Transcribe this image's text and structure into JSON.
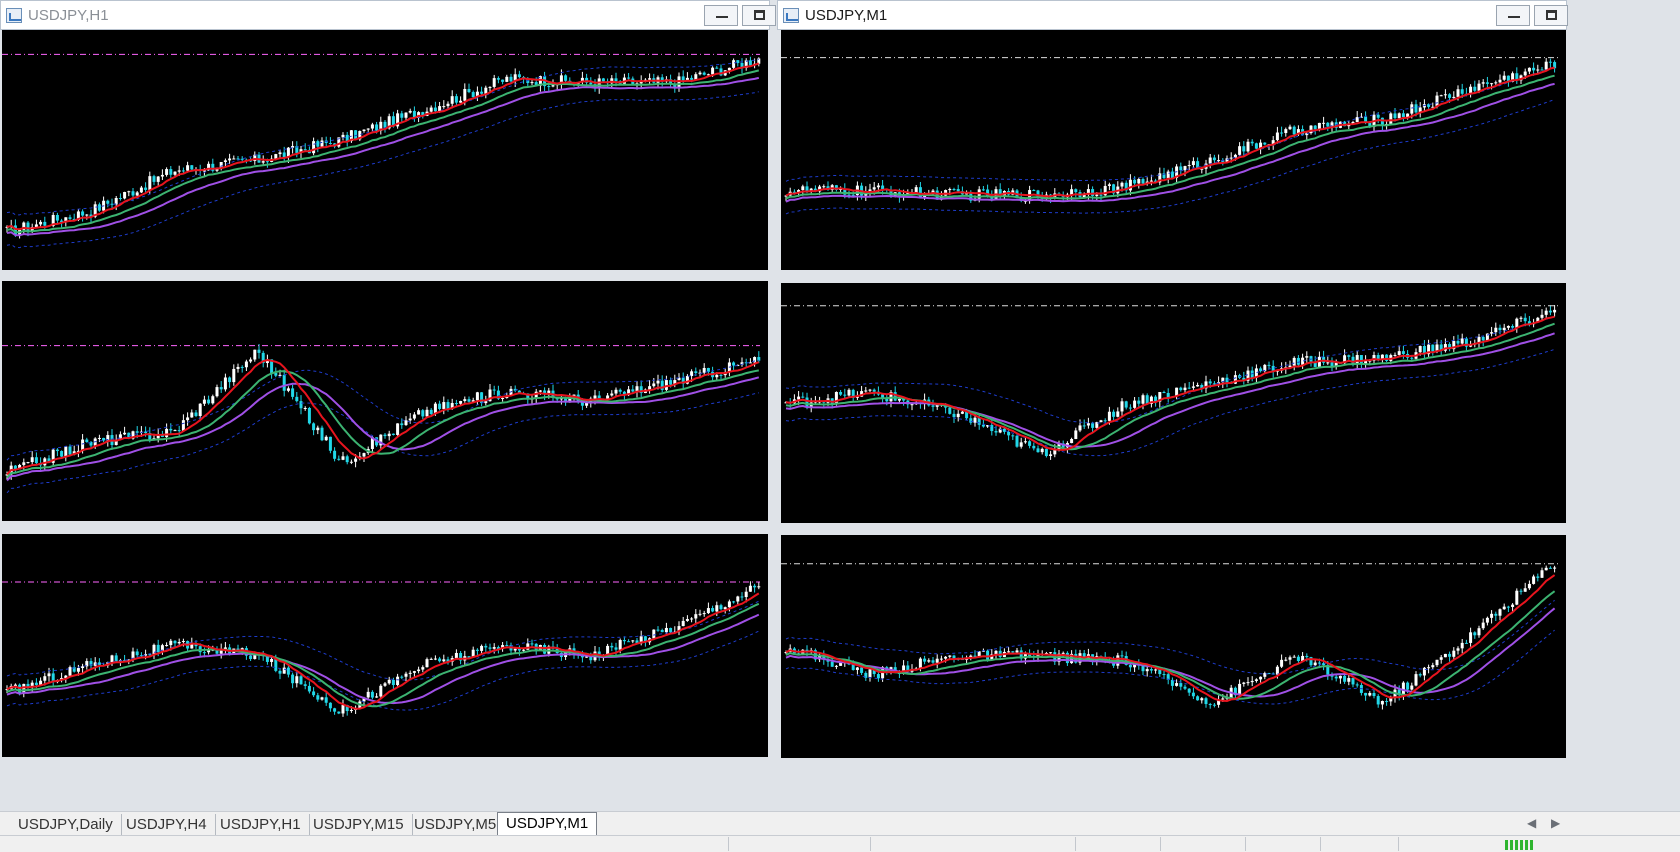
{
  "windows": [
    {
      "title": "USDJPY,H1",
      "active": false
    },
    {
      "title": "USDJPY,M1",
      "active": true
    }
  ],
  "tabs": [
    {
      "label": "USDJPY,Daily",
      "active": false
    },
    {
      "label": "USDJPY,H4",
      "active": false
    },
    {
      "label": "USDJPY,H1",
      "active": false
    },
    {
      "label": "USDJPY,M15",
      "active": false
    },
    {
      "label": "USDJPY,M5",
      "active": false
    },
    {
      "label": "USDJPY,M1",
      "active": true
    }
  ],
  "colors": {
    "chart_background": "#000000",
    "bull_candle": "#ffffff",
    "bear_candle": "#21d7e8",
    "ma_fast": "#e8141e",
    "ma_medium": "#3cb371",
    "ma_slow": "#a050e6",
    "envelope": "#1e3ccc",
    "price_line": "#ff66ff",
    "reference_line": "#dddddd"
  },
  "charts": [
    {
      "name": "chart-top-left",
      "trend": [
        0.1,
        0.2,
        0.4,
        0.45,
        0.55,
        0.7,
        0.85,
        0.83,
        0.83,
        0.95
      ],
      "line": "price"
    },
    {
      "name": "chart-top-right",
      "trend": [
        0.3,
        0.3,
        0.28,
        0.28,
        0.32,
        0.45,
        0.6,
        0.65,
        0.8,
        0.92
      ],
      "line": "reference"
    },
    {
      "name": "chart-mid-left",
      "trend": [
        0.15,
        0.3,
        0.35,
        0.75,
        0.2,
        0.45,
        0.55,
        0.5,
        0.6,
        0.7
      ],
      "line": "price"
    },
    {
      "name": "chart-mid-right",
      "trend": [
        0.5,
        0.55,
        0.45,
        0.25,
        0.5,
        0.6,
        0.7,
        0.72,
        0.8,
        0.95
      ],
      "line": "reference"
    },
    {
      "name": "chart-bottom-left",
      "trend": [
        0.25,
        0.4,
        0.5,
        0.45,
        0.15,
        0.4,
        0.5,
        0.45,
        0.6,
        0.82
      ],
      "line": "price"
    },
    {
      "name": "chart-bottom-right",
      "trend": [
        0.5,
        0.35,
        0.45,
        0.45,
        0.42,
        0.2,
        0.45,
        0.2,
        0.55,
        0.95
      ],
      "line": "reference"
    }
  ]
}
